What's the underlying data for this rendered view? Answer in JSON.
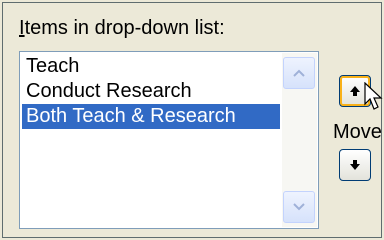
{
  "group": {
    "label_access_key": "I",
    "label_rest": "tems in drop-down list:"
  },
  "list": {
    "items": [
      "Teach",
      "Conduct Research",
      "Both Teach & Research"
    ],
    "selected_index": 2
  },
  "move": {
    "label": "Move",
    "up_icon": "arrow-up-icon",
    "down_icon": "arrow-down-icon"
  },
  "colors": {
    "selection": "#316ac5",
    "focus_border": "#f9b119",
    "dialog_bg": "#ece9d8"
  }
}
